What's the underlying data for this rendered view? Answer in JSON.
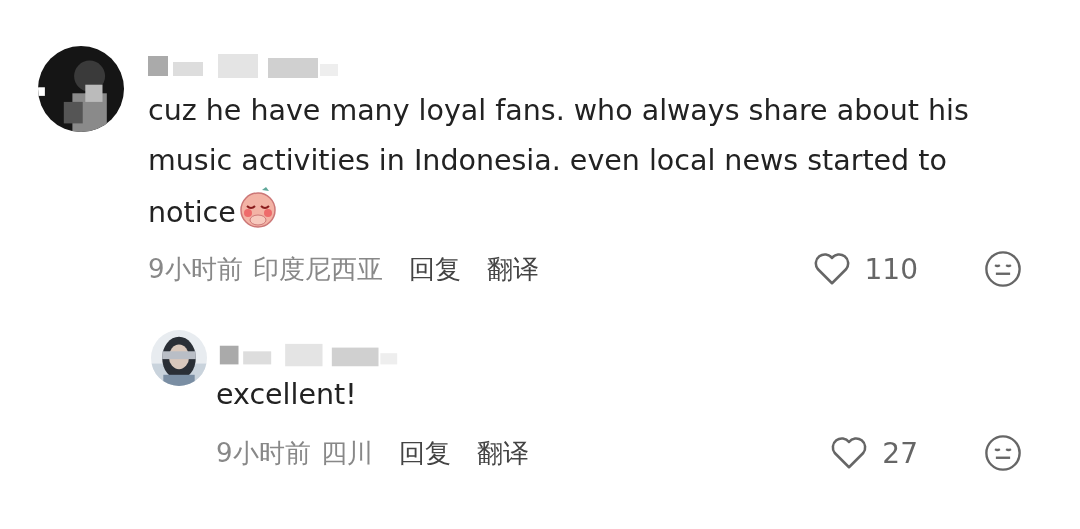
{
  "comments": [
    {
      "text": "cuz he have many loyal fans. who always share about his music activities in Indonesia. even local news started to notice",
      "sticker": true,
      "time": "9小时前",
      "location": "印度尼西亚",
      "reply_label": "回复",
      "translate_label": "翻译",
      "likes": "110",
      "liked": false,
      "reply": false
    },
    {
      "text": "excellent!",
      "sticker": false,
      "time": "9小时前",
      "location": "四川",
      "reply_label": "回复",
      "translate_label": "翻译",
      "likes": "27",
      "liked": false,
      "reply": true
    }
  ]
}
